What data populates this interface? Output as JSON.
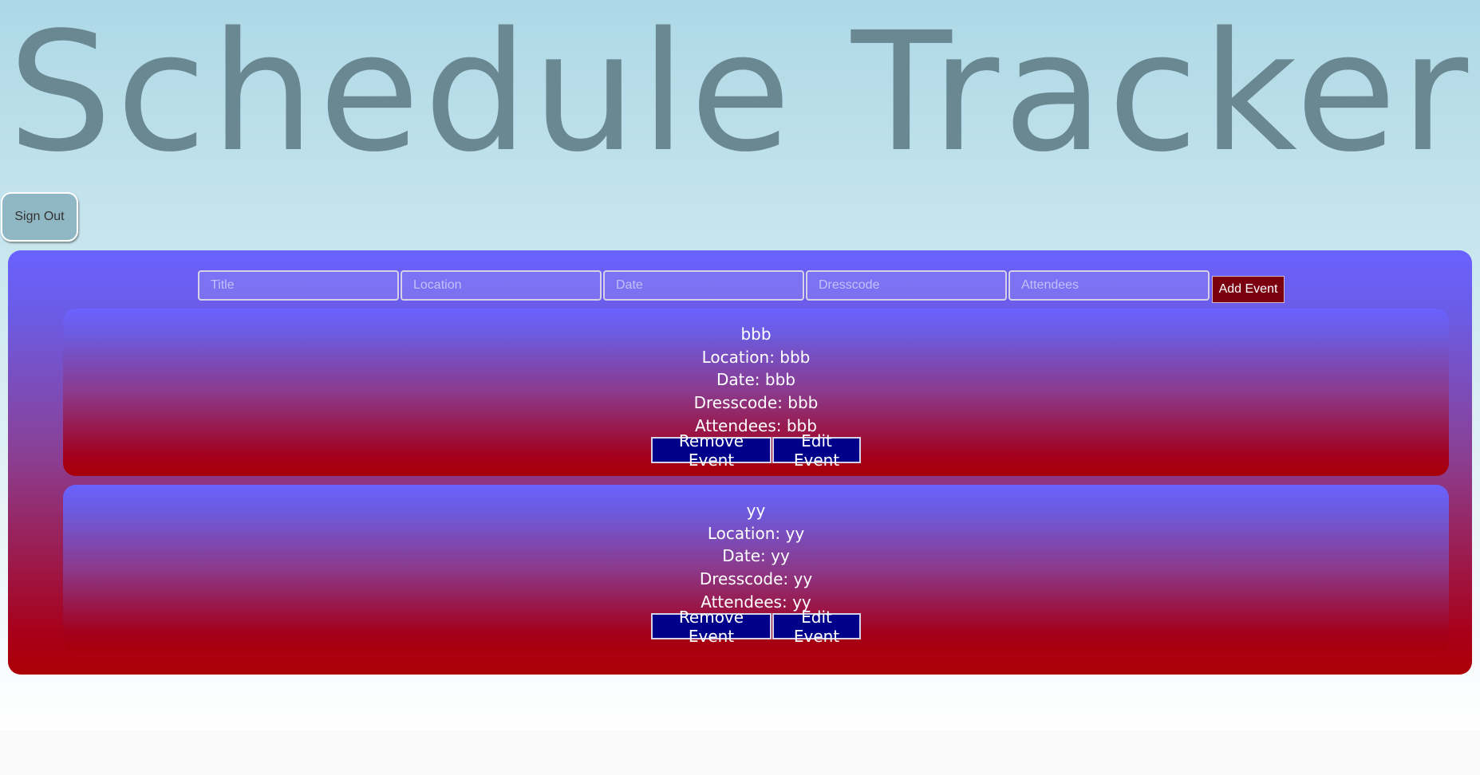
{
  "app": {
    "title": "Schedule Tracker",
    "sign_out_label": "Sign Out"
  },
  "form": {
    "fields": [
      {
        "name": "title-input",
        "placeholder": "Title",
        "value": ""
      },
      {
        "name": "location-input",
        "placeholder": "Location",
        "value": ""
      },
      {
        "name": "date-input",
        "placeholder": "Date",
        "value": ""
      },
      {
        "name": "dresscode-input",
        "placeholder": "Dresscode",
        "value": ""
      },
      {
        "name": "attendees-input",
        "placeholder": "Attendees",
        "value": ""
      }
    ],
    "add_label": "Add Event"
  },
  "events": [
    {
      "title": "bbb",
      "location": "Location: bbb",
      "date": "Date: bbb",
      "dresscode": "Dresscode: bbb",
      "attendees": "Attendees: bbb",
      "remove_label": "Remove Event",
      "edit_label": "Edit Event"
    },
    {
      "title": "yy",
      "location": "Location: yy",
      "date": "Date: yy",
      "dresscode": "Dresscode: yy",
      "attendees": "Attendees: yy",
      "remove_label": "Remove Event",
      "edit_label": "Edit Event"
    }
  ],
  "colors": {
    "header_gradient_top": "#add8e6",
    "title_text": "#6a8891",
    "panel_top": "#6a62ff",
    "panel_bottom": "#ad0006",
    "button_navy": "#00008b",
    "add_button": "#7a0010"
  }
}
